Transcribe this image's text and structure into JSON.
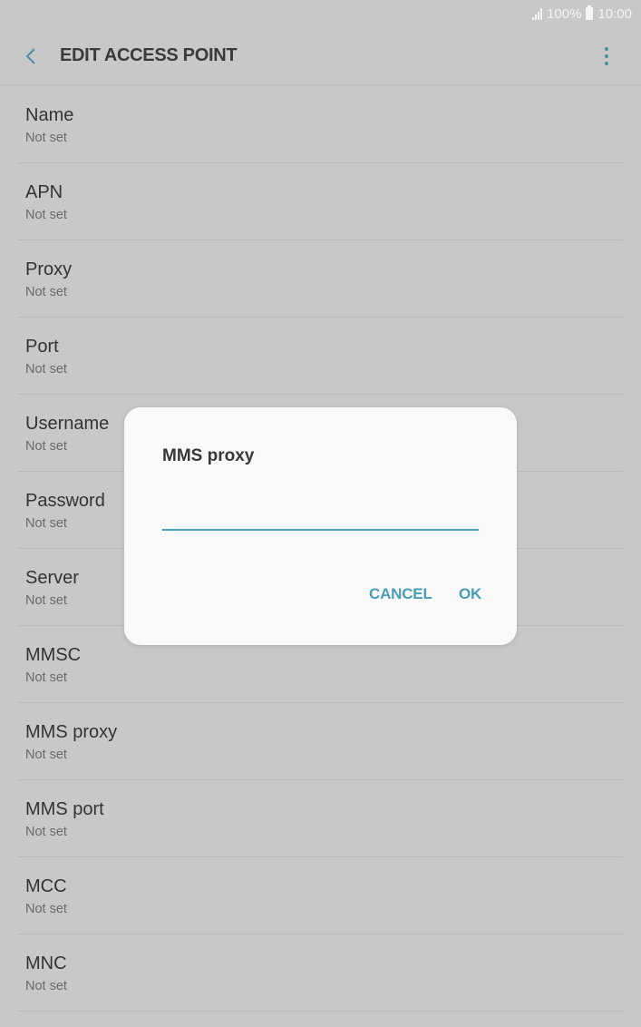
{
  "status_bar": {
    "battery": "100%",
    "time": "10:00"
  },
  "header": {
    "title": "EDIT ACCESS POINT",
    "back_icon": "chevron-left-icon",
    "more_icon": "more-vert-icon"
  },
  "settings": [
    {
      "label": "Name",
      "value": "Not set"
    },
    {
      "label": "APN",
      "value": "Not set"
    },
    {
      "label": "Proxy",
      "value": "Not set"
    },
    {
      "label": "Port",
      "value": "Not set"
    },
    {
      "label": "Username",
      "value": "Not set"
    },
    {
      "label": "Password",
      "value": "Not set"
    },
    {
      "label": "Server",
      "value": "Not set"
    },
    {
      "label": "MMSC",
      "value": "Not set"
    },
    {
      "label": "MMS proxy",
      "value": "Not set"
    },
    {
      "label": "MMS port",
      "value": "Not set"
    },
    {
      "label": "MCC",
      "value": "Not set"
    },
    {
      "label": "MNC",
      "value": "Not set"
    }
  ],
  "dialog": {
    "title": "MMS proxy",
    "input_value": "",
    "cancel_label": "CANCEL",
    "ok_label": "OK"
  },
  "colors": {
    "accent": "#4a9db3",
    "overlay_background": "#c8c8c8",
    "dialog_background": "#f9f9f9"
  }
}
